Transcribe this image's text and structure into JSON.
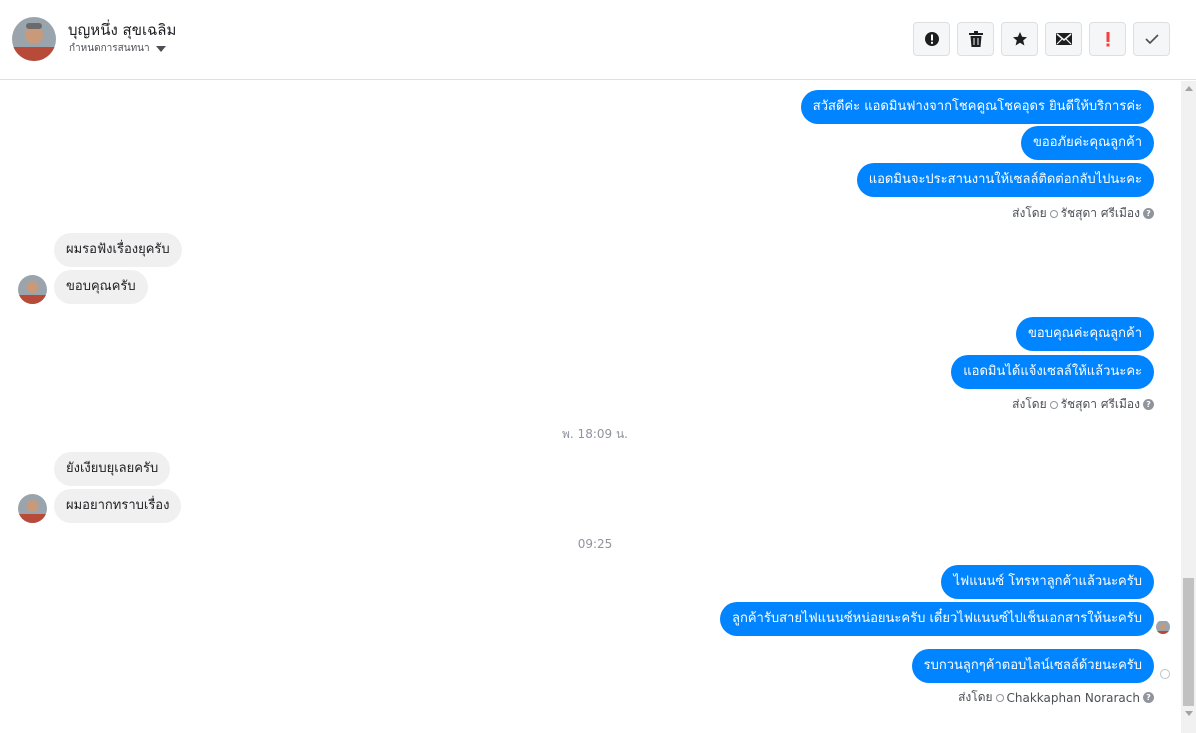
{
  "header": {
    "contact_name": "บุญหนึ่ง สุขเฉลิม",
    "label_select": "กำหนดการสนทนา",
    "toolbar": [
      {
        "name": "spam-button",
        "icon": "alert-circle-icon"
      },
      {
        "name": "delete-button",
        "icon": "trash-icon"
      },
      {
        "name": "star-button",
        "icon": "star-icon"
      },
      {
        "name": "mark-unread-button",
        "icon": "envelope-icon"
      },
      {
        "name": "follow-up-button",
        "icon": "exclamation-icon"
      },
      {
        "name": "mark-done-button",
        "icon": "check-icon"
      }
    ]
  },
  "messages": {
    "out1": "สวัสดีค่ะ แอดมินฟางจากโชคคูณโชคอุดร ยินดีให้บริการค่ะ",
    "out2": "ขออภัยค่ะคุณลูกค้า",
    "out3": "แอดมินจะประสานงานให้เซลล์ติดต่อกลับไปนะคะ",
    "sent_by_1": {
      "prefix": "ส่งโดย",
      "name": "รัชสุดา ศรีเมือง"
    },
    "in1": "ผมรอฟังเรื่องยุครับ",
    "in2": "ขอบคุณครับ",
    "out4": "ขอบคุณค่ะคุณลูกค้า",
    "out5": "แอดมินได้แจ้งเซลล์ให้แล้วนะคะ",
    "sent_by_2": {
      "prefix": "ส่งโดย",
      "name": "รัชสุดา ศรีเมือง"
    },
    "timestamp_1": "พ. 18:09 น.",
    "in3": "ยังเงียบยุเลยครับ",
    "in4": "ผมอยากทราบเรื่อง",
    "timestamp_2": "09:25",
    "out6": "ไฟแนนซ์ โทรหาลูกค้าแล้วนะครับ",
    "out7": "ลูกค้ารับสายไฟแนนซ์หน่อยนะครับ เดี๋ยวไฟแนนซ์ไปเช็นเอกสารให้นะครับ",
    "out8": "รบกวนลูกๆค้าตอบไลน์เซลล์ด้วยนะครับ",
    "sent_by_3": {
      "prefix": "ส่งโดย",
      "name": "Chakkaphan Norarach"
    }
  },
  "colors": {
    "outgoing_bubble": "#0084ff",
    "incoming_bubble": "#f1f0f0",
    "timestamp_text": "#90949c"
  }
}
